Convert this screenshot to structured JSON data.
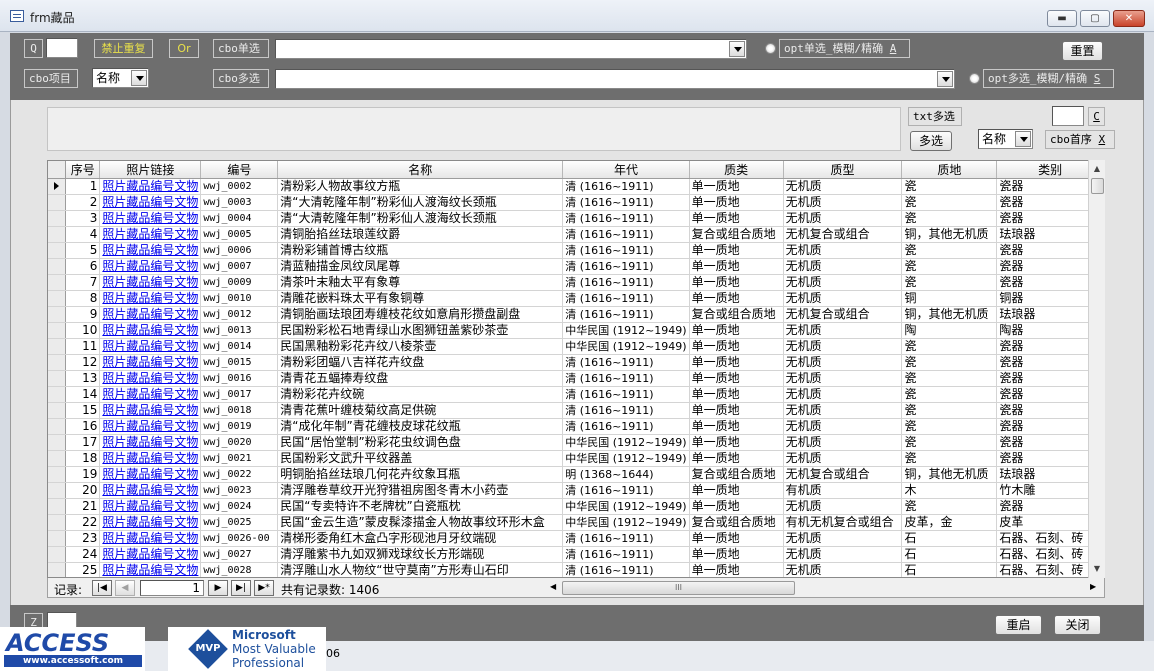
{
  "window": {
    "title": "frm藏品",
    "minimize_glyph": "▬",
    "restore_glyph": "▢",
    "close_glyph": "✕"
  },
  "toolbar": {
    "q_label": "Q",
    "q_value": "",
    "no_dup_label": "禁止重复",
    "or_label": "Or",
    "cbo_single_label": "cbo单选",
    "cbo_single_value": "",
    "opt_single_label": "opt单选_模糊/精确",
    "opt_single_hotkey": "A",
    "reset_button": "重置",
    "cbo_item_label": "cbo项目",
    "cbo_item_value": "名称",
    "cbo_multi_label": "cbo多选",
    "cbo_multi_value": "",
    "opt_multi_label": "opt多选_模糊/精确",
    "opt_multi_hotkey": "S"
  },
  "filter": {
    "txt_multi_label": "txt多选",
    "multi_button": "多选",
    "sort_field_value": "名称",
    "cbo_first_label": "cbo首序",
    "cbo_first_hotkey": "X",
    "c_value": "",
    "c_label": "C"
  },
  "grid": {
    "columns": [
      "序号",
      "照片链接",
      "编号",
      "名称",
      "年代",
      "质类",
      "质型",
      "质地",
      "类别"
    ],
    "rows": [
      [
        "1",
        "照片藏品编号文物",
        "wwj_0002",
        "清粉彩人物故事纹方瓶",
        "清 (1616~1911)",
        "单一质地",
        "无机质",
        "瓷",
        "瓷器"
      ],
      [
        "2",
        "照片藏品编号文物",
        "wwj_0003",
        "清“大清乾隆年制”粉彩仙人渡海纹长颈瓶",
        "清 (1616~1911)",
        "单一质地",
        "无机质",
        "瓷",
        "瓷器"
      ],
      [
        "3",
        "照片藏品编号文物",
        "wwj_0004",
        "清“大清乾隆年制”粉彩仙人渡海纹长颈瓶",
        "清 (1616~1911)",
        "单一质地",
        "无机质",
        "瓷",
        "瓷器"
      ],
      [
        "4",
        "照片藏品编号文物",
        "wwj_0005",
        "清铜胎掐丝珐琅莲纹爵",
        "清 (1616~1911)",
        "复合或组合质地",
        "无机复合或组合",
        "铜，其他无机质",
        "珐琅器"
      ],
      [
        "5",
        "照片藏品编号文物",
        "wwj_0006",
        "清粉彩铺首博古纹瓶",
        "清 (1616~1911)",
        "单一质地",
        "无机质",
        "瓷",
        "瓷器"
      ],
      [
        "6",
        "照片藏品编号文物",
        "wwj_0007",
        "清蓝釉描金凤纹凤尾尊",
        "清 (1616~1911)",
        "单一质地",
        "无机质",
        "瓷",
        "瓷器"
      ],
      [
        "7",
        "照片藏品编号文物",
        "wwj_0009",
        "清茶叶末釉太平有象尊",
        "清 (1616~1911)",
        "单一质地",
        "无机质",
        "瓷",
        "瓷器"
      ],
      [
        "8",
        "照片藏品编号文物",
        "wwj_0010",
        "清雕花嵌料珠太平有象铜尊",
        "清 (1616~1911)",
        "单一质地",
        "无机质",
        "铜",
        "铜器"
      ],
      [
        "9",
        "照片藏品编号文物",
        "wwj_0012",
        "清铜胎画珐琅团寿缠枝花纹如意肩形攒盘副盘",
        "清 (1616~1911)",
        "复合或组合质地",
        "无机复合或组合",
        "铜，其他无机质",
        "珐琅器"
      ],
      [
        "10",
        "照片藏品编号文物",
        "wwj_0013",
        "民国粉彩松石地青绿山水图狮钮盖紫砂茶壶",
        "中华民国 (1912~1949)",
        "单一质地",
        "无机质",
        "陶",
        "陶器"
      ],
      [
        "11",
        "照片藏品编号文物",
        "wwj_0014",
        "民国黑釉粉彩花卉纹八棱茶壶",
        "中华民国 (1912~1949)",
        "单一质地",
        "无机质",
        "瓷",
        "瓷器"
      ],
      [
        "12",
        "照片藏品编号文物",
        "wwj_0015",
        "清粉彩团蝠八吉祥花卉纹盘",
        "清 (1616~1911)",
        "单一质地",
        "无机质",
        "瓷",
        "瓷器"
      ],
      [
        "13",
        "照片藏品编号文物",
        "wwj_0016",
        "清青花五蝠捧寿纹盘",
        "清 (1616~1911)",
        "单一质地",
        "无机质",
        "瓷",
        "瓷器"
      ],
      [
        "14",
        "照片藏品编号文物",
        "wwj_0017",
        "清粉彩花卉纹碗",
        "清 (1616~1911)",
        "单一质地",
        "无机质",
        "瓷",
        "瓷器"
      ],
      [
        "15",
        "照片藏品编号文物",
        "wwj_0018",
        "清青花蕉叶缠枝菊纹高足供碗",
        "清 (1616~1911)",
        "单一质地",
        "无机质",
        "瓷",
        "瓷器"
      ],
      [
        "16",
        "照片藏品编号文物",
        "wwj_0019",
        "清“成化年制”青花缠枝皮球花纹瓶",
        "清 (1616~1911)",
        "单一质地",
        "无机质",
        "瓷",
        "瓷器"
      ],
      [
        "17",
        "照片藏品编号文物",
        "wwj_0020",
        "民国“居怡堂制”粉彩花虫纹调色盘",
        "中华民国 (1912~1949)",
        "单一质地",
        "无机质",
        "瓷",
        "瓷器"
      ],
      [
        "18",
        "照片藏品编号文物",
        "wwj_0021",
        "民国粉彩文武升平纹器盖",
        "中华民国 (1912~1949)",
        "单一质地",
        "无机质",
        "瓷",
        "瓷器"
      ],
      [
        "19",
        "照片藏品编号文物",
        "wwj_0022",
        "明铜胎掐丝珐琅几何花卉纹象耳瓶",
        "明 (1368~1644)",
        "复合或组合质地",
        "无机复合或组合",
        "铜，其他无机质",
        "珐琅器"
      ],
      [
        "20",
        "照片藏品编号文物",
        "wwj_0023",
        "清浮雕卷草纹开光狩猎祖房图冬青木小药壶",
        "清 (1616~1911)",
        "单一质地",
        "有机质",
        "木",
        "竹木雕"
      ],
      [
        "21",
        "照片藏品编号文物",
        "wwj_0024",
        "民国“专卖特许不老牌枕”白瓷瓶枕",
        "中华民国 (1912~1949)",
        "单一质地",
        "无机质",
        "瓷",
        "瓷器"
      ],
      [
        "22",
        "照片藏品编号文物",
        "wwj_0025",
        "民国“金云生造”蒙皮髹漆描金人物故事纹环形木盒",
        "中华民国 (1912~1949)",
        "复合或组合质地",
        "有机无机复合或组合",
        "皮革，金",
        "皮革"
      ],
      [
        "23",
        "照片藏品编号文物",
        "wwj_0026-00",
        "清梯形委角红木盒凸字形砚池月牙纹端砚",
        "清 (1616~1911)",
        "单一质地",
        "无机质",
        "石",
        "石器、石刻、砖"
      ],
      [
        "24",
        "照片藏品编号文物",
        "wwj_0027",
        "清浮雕紫书九如双狮戏球纹长方形端砚",
        "清 (1616~1911)",
        "单一质地",
        "无机质",
        "石",
        "石器、石刻、砖"
      ],
      [
        "25",
        "照片藏品编号文物",
        "wwj_0028",
        "清浮雕山水人物纹“世守莫南”方形寿山石印",
        "清 (1616~1911)",
        "单一质地",
        "无机质",
        "石",
        "石器、石刻、砖"
      ]
    ]
  },
  "navigation": {
    "record_label": "记录:",
    "current_record": "1",
    "total_text": "共有记录数: 1406",
    "scroll_thumb_glyph": "III"
  },
  "bottom": {
    "z_label": "Z",
    "restart_button": "重启",
    "close_button": "关闭",
    "status_fragment": "06"
  },
  "logos": {
    "access_word": "ACCESS",
    "access_url": "www.accessoft.com",
    "mvp_badge": "MVP",
    "mvp_line1": "Microsoft",
    "mvp_line2": "Most Valuable",
    "mvp_line3": "Professional"
  }
}
